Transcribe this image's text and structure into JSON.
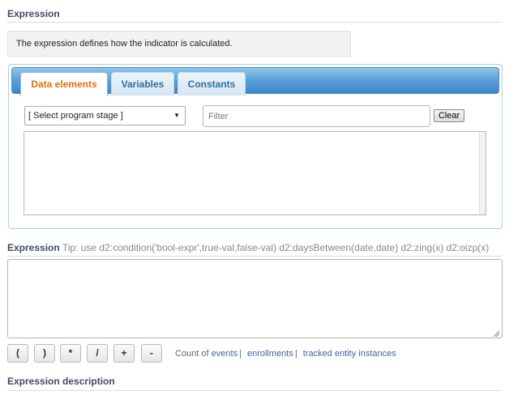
{
  "expression_section": {
    "title": "Expression",
    "description": "The expression defines how the indicator is calculated."
  },
  "tabs": [
    {
      "label": "Data elements",
      "active": true
    },
    {
      "label": "Variables",
      "active": false
    },
    {
      "label": "Constants",
      "active": false
    }
  ],
  "data_elements": {
    "program_stage_select": {
      "selected": "[ Select program stage ]"
    },
    "filter": {
      "placeholder": "Filter",
      "value": ""
    },
    "clear_label": "Clear"
  },
  "expression_editor": {
    "label": "Expression",
    "tip": "Tip: use d2:condition('bool-expr',true-val,false-val) d2:daysBetween(date,date) d2:zing(x) d2:oizp(x)",
    "value": ""
  },
  "operators": [
    "(",
    ")",
    "*",
    "/",
    "+",
    "-"
  ],
  "count_of": {
    "prefix": "Count of",
    "links": [
      "events",
      "enrollments",
      "tracked entity instances"
    ],
    "separator": "|"
  },
  "description_section": {
    "title": "Expression description"
  },
  "colors": {
    "accent_active_tab": "#e17009",
    "tab_text": "#2e6e9e",
    "section_title": "#3c4b63",
    "link": "#3d65a3",
    "tab_bar": "#5aa0d6"
  }
}
